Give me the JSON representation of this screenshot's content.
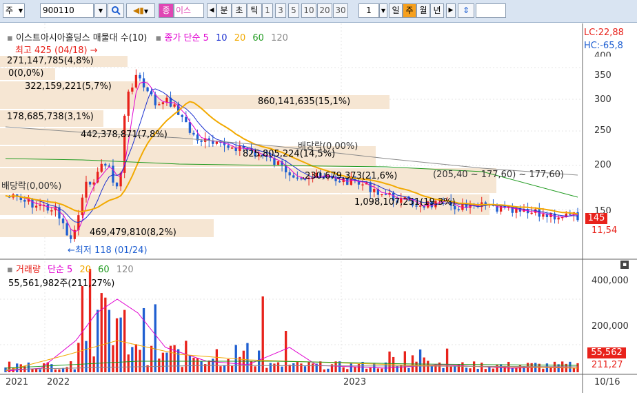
{
  "toolbar": {
    "market": "주",
    "code": "900110",
    "stock_tag": "종",
    "stock_name": "이스",
    "intervals": [
      "분",
      "초",
      "틱"
    ],
    "numbers": [
      "1",
      "3",
      "5",
      "10",
      "20",
      "30"
    ],
    "count_value": "1",
    "periods": [
      "일",
      "주",
      "월",
      "년"
    ],
    "selected_period": "주"
  },
  "price_panel": {
    "title": "이스트아시아홀딩스 매물대 수(10)",
    "ma_label": "종가 단순",
    "ma_periods": [
      "5",
      "10",
      "20",
      "60",
      "120"
    ],
    "lc": "LC:22,88",
    "hc": "HC:-65,8",
    "y_ticks": [
      "350",
      "300",
      "250",
      "200",
      "150"
    ],
    "y_top_partial": "400",
    "current_price": "145",
    "current_pct": "11,54",
    "annotations": {
      "high": "최고 425 (04/18)",
      "low": "최저 118 (01/24)",
      "dividend1": "배당락(0,00%)",
      "dividend2": "배당락(0,00%)",
      "range_info": "(205,40 ~ 177,60)"
    },
    "volume_profile": [
      "271,147,785(4,8%)",
      "0(0,0%)",
      "322,159,221(5,7%)",
      "860,141,635(15,1%)",
      "178,685,738(3,1%)",
      "442,378,871(7,8%)",
      "825,805,224(14,5%)",
      ",230,679,373(21,6%)",
      "1,098,107,251(19,3%)",
      "469,479,810(8,2%)"
    ]
  },
  "volume_panel": {
    "title": "거래량",
    "ma_label": "단순",
    "ma_periods": [
      "5",
      "20",
      "60",
      "120"
    ],
    "last_value": "55,561,982주(211,27%)",
    "y_ticks": [
      "400,000",
      "200,000"
    ],
    "current": "55,562",
    "current_pct": "211,27"
  },
  "x_axis": {
    "labels": [
      "2021",
      "2022",
      "2023"
    ],
    "right_label": "10/16"
  },
  "colors": {
    "up": "#e8221b",
    "down": "#1f5fd1",
    "ma5": "#e000d0",
    "ma10": "#1a2fd0",
    "ma20": "#f2a900",
    "ma60": "#1f9a1f",
    "ma120": "#8a8a8a",
    "profile": "#f6e6d3"
  }
}
